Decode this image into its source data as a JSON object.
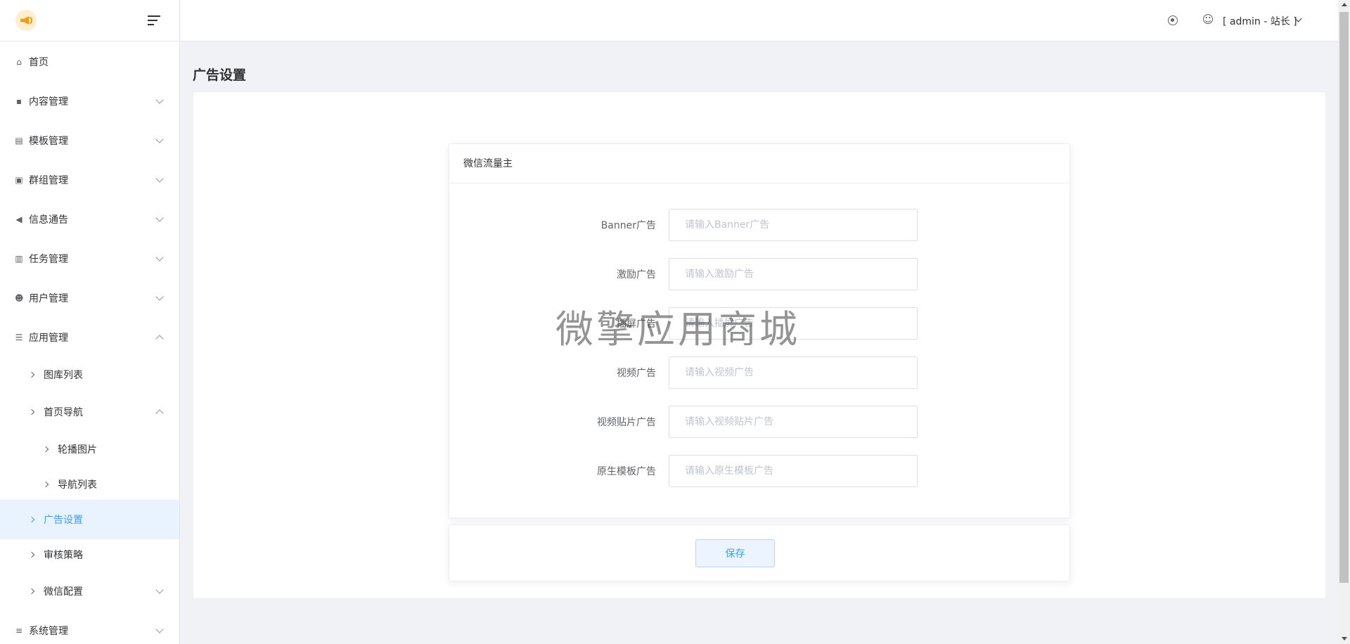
{
  "sidebar": {
    "logo_icon": "megaphone-logo-icon",
    "collapse_icon": "menu-fold-icon",
    "items": [
      {
        "label": "首页",
        "icon": "home-icon"
      },
      {
        "label": "内容管理",
        "icon": "message-icon"
      },
      {
        "label": "模板管理",
        "icon": "images-icon"
      },
      {
        "label": "群组管理",
        "icon": "group-icon"
      },
      {
        "label": "信息通告",
        "icon": "bullhorn-icon"
      },
      {
        "label": "任务管理",
        "icon": "copy-icon"
      },
      {
        "label": "用户管理",
        "icon": "users-icon"
      },
      {
        "label": "应用管理",
        "icon": "sliders-icon"
      },
      {
        "label": "图库列表"
      },
      {
        "label": "首页导航"
      },
      {
        "label": "轮播图片"
      },
      {
        "label": "导航列表"
      },
      {
        "label": "广告设置"
      },
      {
        "label": "审核策略"
      },
      {
        "label": "微信配置"
      },
      {
        "label": "系统管理",
        "icon": "list-icon"
      }
    ]
  },
  "header": {
    "user_label": "[ admin - 站长 ]"
  },
  "page": {
    "title": "广告设置"
  },
  "card": {
    "title": "微信流量主",
    "fields": [
      {
        "label": "Banner广告",
        "placeholder": "请输入Banner广告"
      },
      {
        "label": "激励广告",
        "placeholder": "请输入激励广告"
      },
      {
        "label": "插屏广告",
        "placeholder": "请输入插屏广告"
      },
      {
        "label": "视频广告",
        "placeholder": "请输入视频广告"
      },
      {
        "label": "视频贴片广告",
        "placeholder": "请输入视频贴片广告"
      },
      {
        "label": "原生模板广告",
        "placeholder": "请输入原生模板广告"
      }
    ],
    "save_label": "保存"
  },
  "watermark": "微擎应用商城",
  "colors": {
    "accent": "#409eff",
    "active_bg": "#e8f3ff",
    "logo": "#f39c12"
  }
}
